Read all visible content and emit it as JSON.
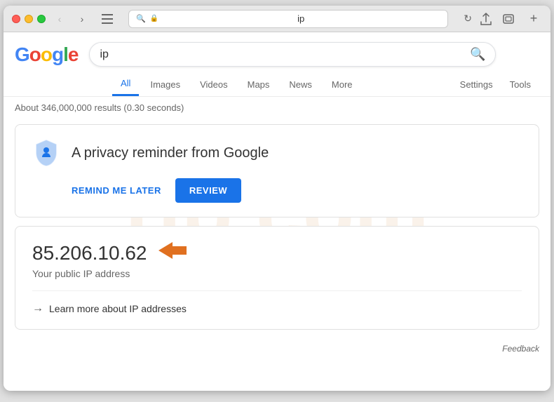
{
  "browser": {
    "address": "ip",
    "address_display": "🔍 🔒 ip"
  },
  "google": {
    "logo": {
      "G": "G",
      "o1": "o",
      "o2": "o",
      "g": "g",
      "l": "l",
      "e": "e"
    },
    "search_query": "ip"
  },
  "nav": {
    "tabs": [
      {
        "label": "All",
        "active": true
      },
      {
        "label": "Images",
        "active": false
      },
      {
        "label": "Videos",
        "active": false
      },
      {
        "label": "Maps",
        "active": false
      },
      {
        "label": "News",
        "active": false
      },
      {
        "label": "More",
        "active": false
      }
    ],
    "settings": "Settings",
    "tools": "Tools"
  },
  "results": {
    "info": "About 346,000,000 results (0.30 seconds)"
  },
  "privacy_card": {
    "title": "A privacy reminder from Google",
    "remind_label": "REMIND ME LATER",
    "review_label": "REVIEW"
  },
  "ip_card": {
    "ip_address": "85.206.10.62",
    "ip_label": "Your public IP address",
    "learn_more": "Learn more about IP addresses"
  },
  "feedback": {
    "label": "Feedback"
  }
}
